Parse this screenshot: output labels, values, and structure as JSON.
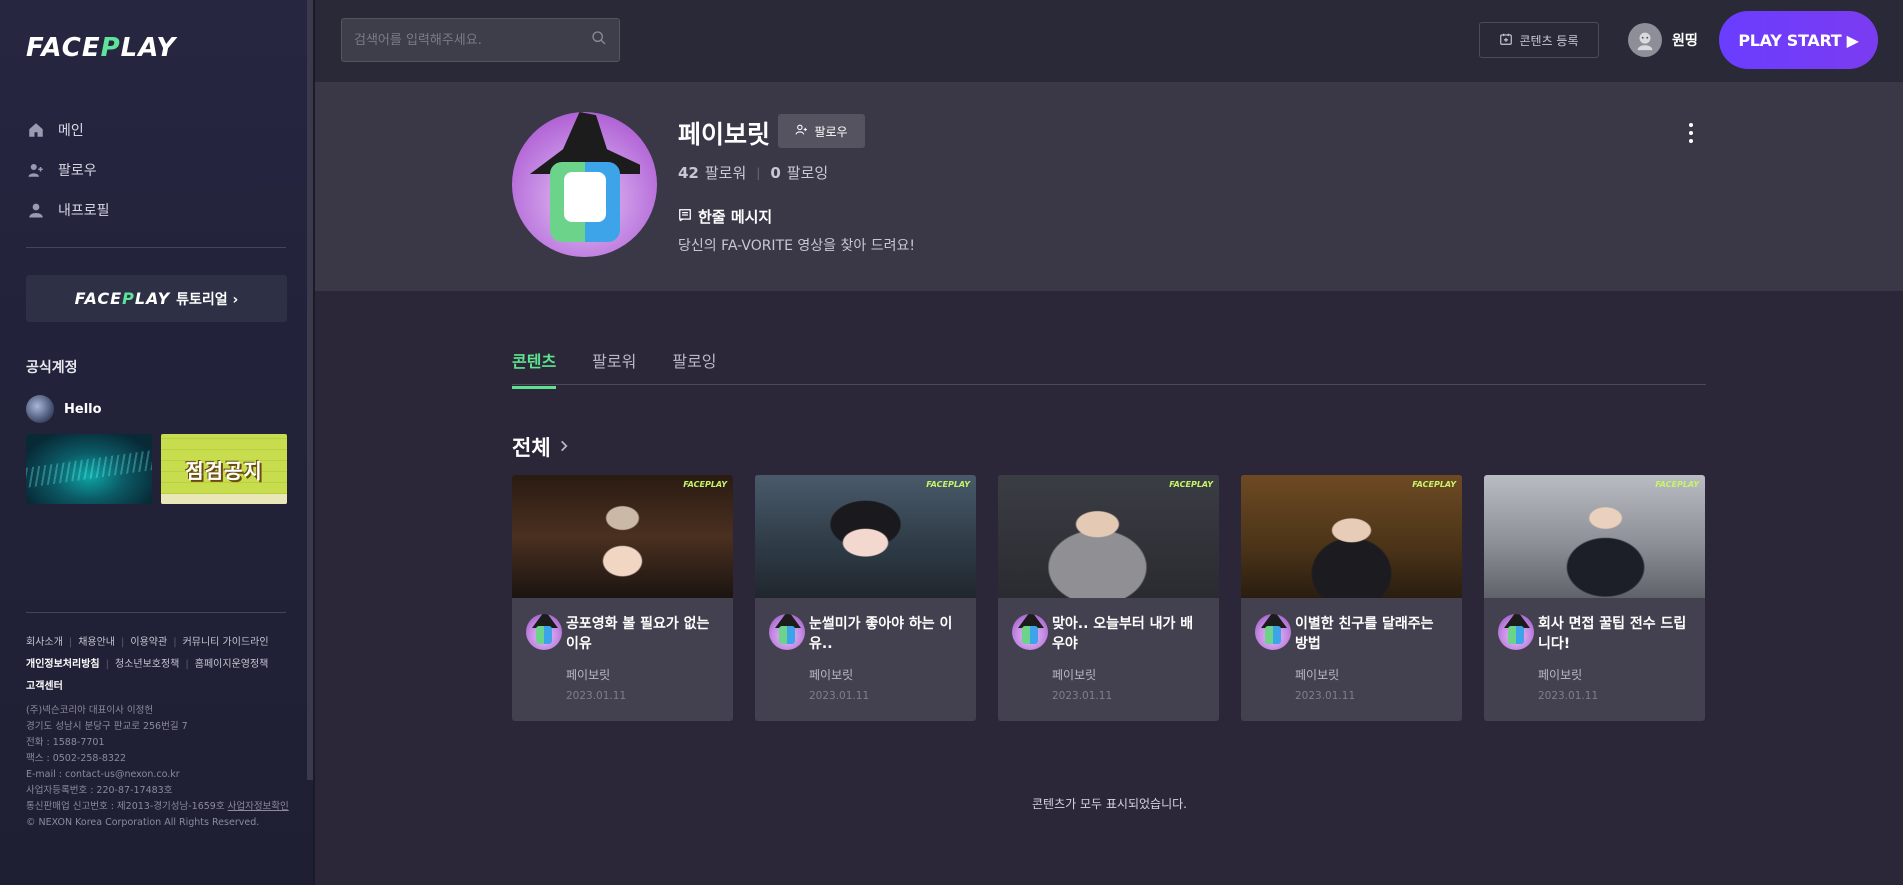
{
  "sidebar": {
    "logo": {
      "pre": "FACE",
      "p": "P",
      "post": "LAY"
    },
    "nav": [
      {
        "label": "메인",
        "icon": "home-icon"
      },
      {
        "label": "팔로우",
        "icon": "user-add-icon"
      },
      {
        "label": "내프로필",
        "icon": "user-icon"
      }
    ],
    "tutorial": {
      "logo_pre": "FACE",
      "logo_p": "P",
      "logo_post": "LAY",
      "label": "튜토리얼 ›"
    },
    "official_title": "공식계정",
    "official_account": "Hello",
    "official_thumb_b_text": "점검공지",
    "footer_links": {
      "about": "회사소개",
      "careers": "채용안내",
      "terms": "이용약관",
      "community": "커뮤니티 가이드라인",
      "privacy": "개인정보처리방침",
      "youth": "청소년보호정책",
      "homepage_policy": "홈페이지운영정책",
      "support": "고객센터"
    },
    "corp": {
      "line1": "(주)넥슨코리아 대표이사 이정헌",
      "line2": "경기도 성남시 분당구 판교로 256번길 7",
      "line3": "전화 : 1588-7701",
      "line4": "팩스 : 0502-258-8322",
      "line5": "E-mail : contact-us@nexon.co.kr",
      "line6": "사업자등록번호 : 220-87-17483호",
      "line7_pre": "통신판매업 신고번호 : 제2013-경기성남-1659호 ",
      "line7_link": "사업자정보확인",
      "line8": "© NEXON Korea Corporation All Rights Reserved."
    }
  },
  "header": {
    "search_placeholder": "검색어를 입력해주세요.",
    "content_register": "콘텐츠 등록",
    "username": "원띵",
    "play_start": "PLAY START ▶"
  },
  "profile": {
    "name": "페이보릿",
    "follow_label": "팔로우",
    "followers_count": "42",
    "followers_label": "팔로워",
    "following_count": "0",
    "following_label": "팔로잉",
    "oneline_title": "한줄 메시지",
    "oneline_message": "당신의 FA-VORITE 영상을 찾아 드려요!"
  },
  "tabs": [
    {
      "label": "콘텐츠",
      "active": true
    },
    {
      "label": "팔로워",
      "active": false
    },
    {
      "label": "팔로잉",
      "active": false
    }
  ],
  "section": {
    "title": "전체"
  },
  "cards": [
    {
      "title": "공포영화 볼 필요가 없는 이유",
      "author": "페이보릿",
      "date": "2023.01.11",
      "badge": "FACEPLAY"
    },
    {
      "title": "눈썰미가 좋아야 하는 이유..",
      "author": "페이보릿",
      "date": "2023.01.11",
      "badge": "FACEPLAY"
    },
    {
      "title": "맞아.. 오늘부터 내가 배우야",
      "author": "페이보릿",
      "date": "2023.01.11",
      "badge": "FACEPLAY"
    },
    {
      "title": "이별한 친구를 달래주는 방법",
      "author": "페이보릿",
      "date": "2023.01.11",
      "badge": "FACEPLAY"
    },
    {
      "title": "회사 면접 꿀팁 전수 드립니다!",
      "author": "페이보릿",
      "date": "2023.01.11",
      "badge": "FACEPLAY"
    }
  ],
  "end_message": "콘텐츠가 모두 표시되었습니다.",
  "colors": {
    "accent_green": "#5de38f",
    "play_purple": "#6a3dff"
  }
}
